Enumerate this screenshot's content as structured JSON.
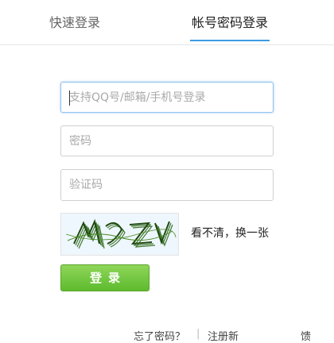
{
  "tabs": {
    "quick_login": "快速登录",
    "account_login": "帐号密码登录"
  },
  "form": {
    "username_placeholder": "支持QQ号/邮箱/手机号登录",
    "password_placeholder": "密码",
    "captcha_placeholder": "验证码",
    "captcha_text": "MAZV",
    "refresh_captcha": "看不清，换一张",
    "login_button": "登录"
  },
  "footer": {
    "forgot_password": "忘了密码？",
    "separator": "|",
    "register": "注册新",
    "feedback": "馈"
  },
  "colors": {
    "accent_blue": "#3c9be3",
    "login_green": "#5ebb2e"
  }
}
